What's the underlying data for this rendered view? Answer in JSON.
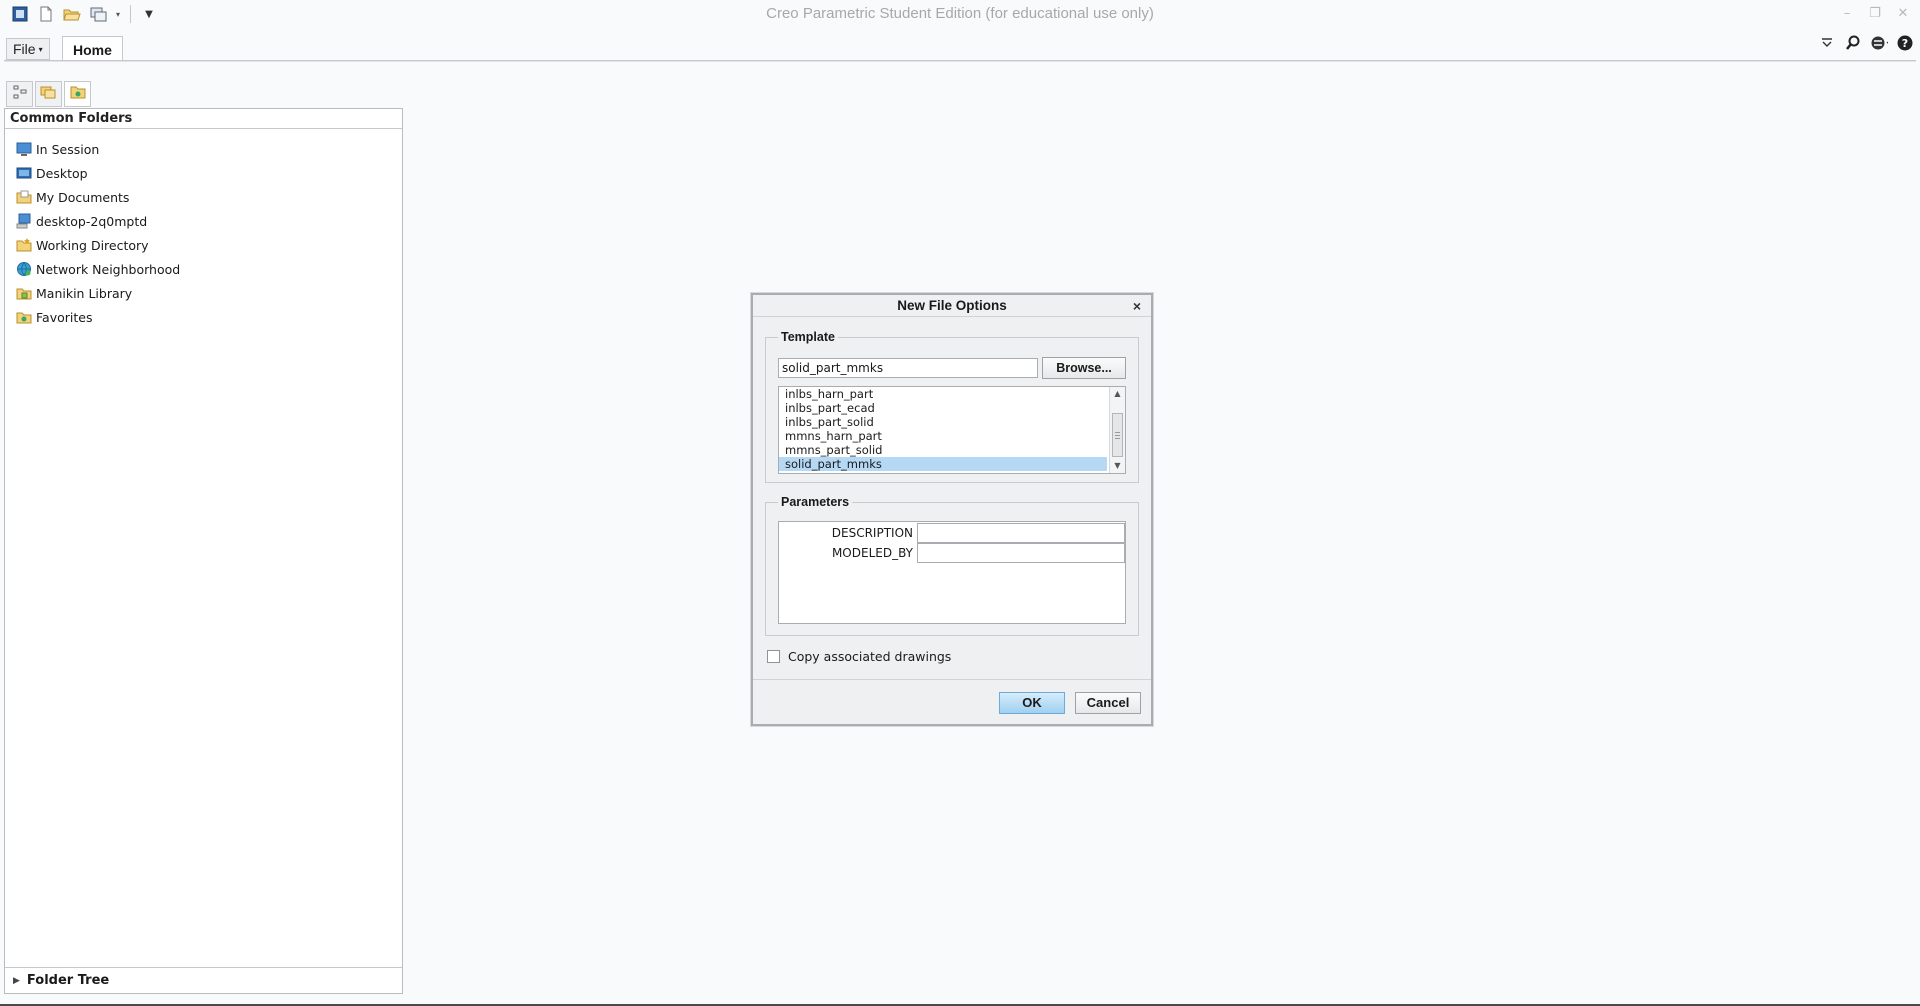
{
  "window": {
    "title": "Creo Parametric Student Edition (for educational use only)"
  },
  "quick_access": {
    "icons": [
      "creo-logo-icon",
      "new-file-icon",
      "open-file-icon",
      "window-icon",
      "dropdown-icon",
      "customize-icon"
    ]
  },
  "ribbon": {
    "file_label": "File",
    "home_label": "Home"
  },
  "navigator": {
    "header": "Common Folders",
    "folders": [
      {
        "label": "In Session",
        "icon": "monitor-icon"
      },
      {
        "label": "Desktop",
        "icon": "desktop-icon"
      },
      {
        "label": "My Documents",
        "icon": "documents-icon"
      },
      {
        "label": "desktop-2q0mptd",
        "icon": "computer-icon"
      },
      {
        "label": "Working Directory",
        "icon": "working-folder-icon"
      },
      {
        "label": "Network Neighborhood",
        "icon": "network-icon"
      },
      {
        "label": "Manikin Library",
        "icon": "library-icon"
      },
      {
        "label": "Favorites",
        "icon": "favorites-icon"
      }
    ],
    "folder_tree_label": "Folder Tree"
  },
  "dialog": {
    "title": "New File Options",
    "template": {
      "label": "Template",
      "value": "solid_part_mmks",
      "browse_label": "Browse...",
      "items": [
        "inlbs_harn_part",
        "inlbs_part_ecad",
        "inlbs_part_solid",
        "mmns_harn_part",
        "mmns_part_solid",
        "solid_part_mmks"
      ],
      "selected": "solid_part_mmks"
    },
    "parameters": {
      "label": "Parameters",
      "rows": [
        {
          "name": "DESCRIPTION",
          "value": ""
        },
        {
          "name": "MODELED_BY",
          "value": ""
        }
      ]
    },
    "copy_drawings_label": "Copy associated drawings",
    "copy_drawings_checked": false,
    "ok_label": "OK",
    "cancel_label": "Cancel"
  }
}
